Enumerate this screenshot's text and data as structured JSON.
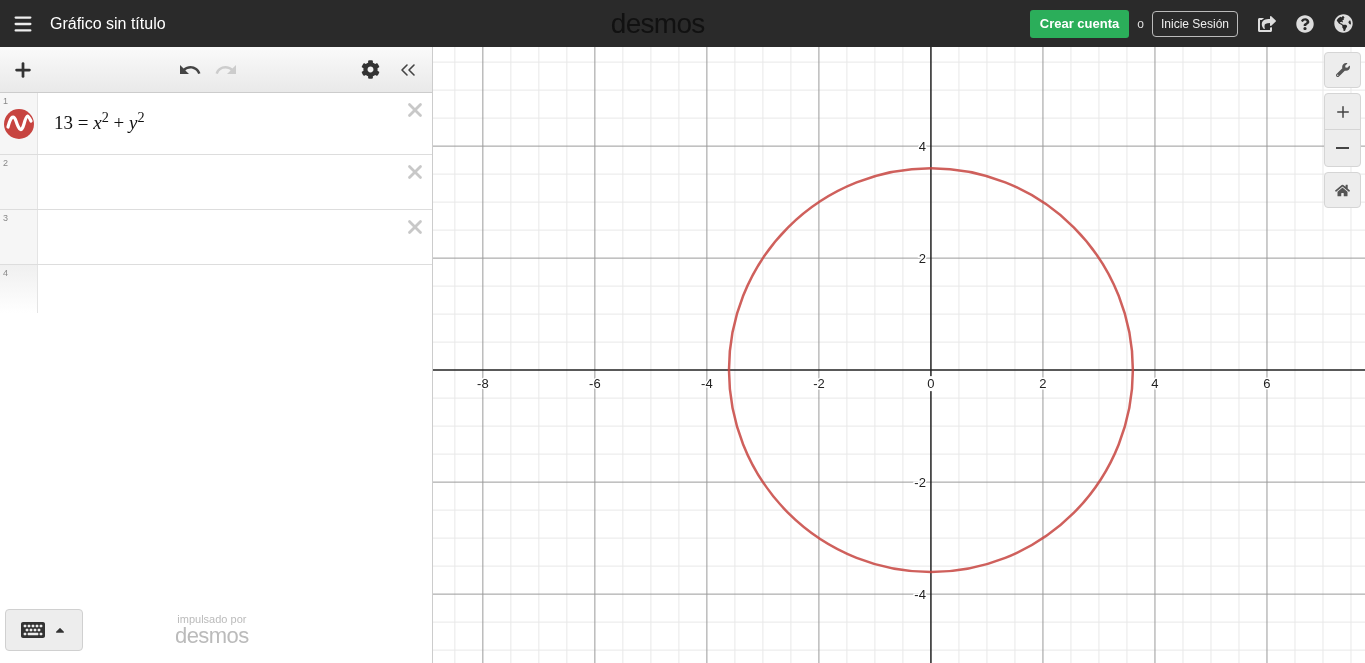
{
  "topbar": {
    "title": "Gráfico sin título",
    "logo": "desmos",
    "create_account": "Crear cuenta",
    "or": "o",
    "login": "Inicie Sesión"
  },
  "expressions": [
    {
      "number": "1",
      "kind": "expression",
      "latex": "13 = *x*$^{2}$ + *y*$^{2}$",
      "color": "#c74440"
    },
    {
      "number": "2",
      "kind": "expression"
    },
    {
      "number": "3",
      "kind": "expression"
    },
    {
      "number": "4",
      "kind": "new"
    }
  ],
  "footer": {
    "powered_by": "impulsado por",
    "logo": "desmos"
  },
  "graph": {
    "chart_data": {
      "type": "line",
      "xlim": [
        -8.89,
        7.75
      ],
      "ylim": [
        -5.23,
        5.77
      ],
      "grid": true,
      "xticks": [
        -8,
        -6,
        -4,
        -2,
        0,
        2,
        4,
        6
      ],
      "yticks": [
        -4,
        -2,
        2,
        4
      ]
    }
  }
}
